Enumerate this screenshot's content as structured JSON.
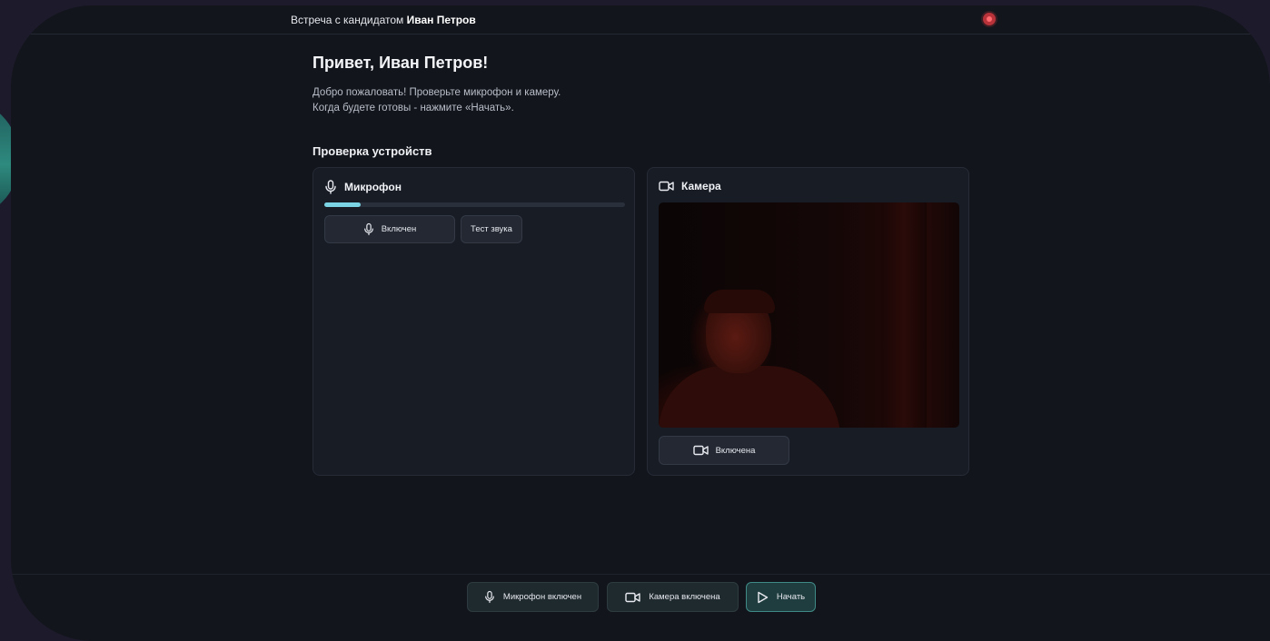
{
  "header": {
    "meeting_prefix": "Встреча с кандидатом",
    "candidate_name": "Иван Петров",
    "recording_indicator_color": "#b8323a"
  },
  "greeting": "Привет, Иван Петров!",
  "intro": {
    "line1": "Добро пожаловать! Проверьте микрофон и камеру.",
    "line2": "Когда будете готовы - нажмите «Начать»."
  },
  "devices": {
    "section_title": "Проверка устройств",
    "microphone": {
      "title": "Микрофон",
      "icon": "microphone-icon",
      "level_percent": 12,
      "toggle_label": "Включен",
      "test_label": "Тест звука"
    },
    "camera": {
      "title": "Камера",
      "icon": "video-camera-icon",
      "toggle_label": "Включена"
    }
  },
  "toolbar": {
    "mic_label": "Микрофон включен",
    "camera_label": "Камера включена",
    "start_label": "Начать"
  },
  "colors": {
    "accent": "#7ad4e4",
    "start_border": "#3f8a86",
    "background": "#12151b"
  }
}
